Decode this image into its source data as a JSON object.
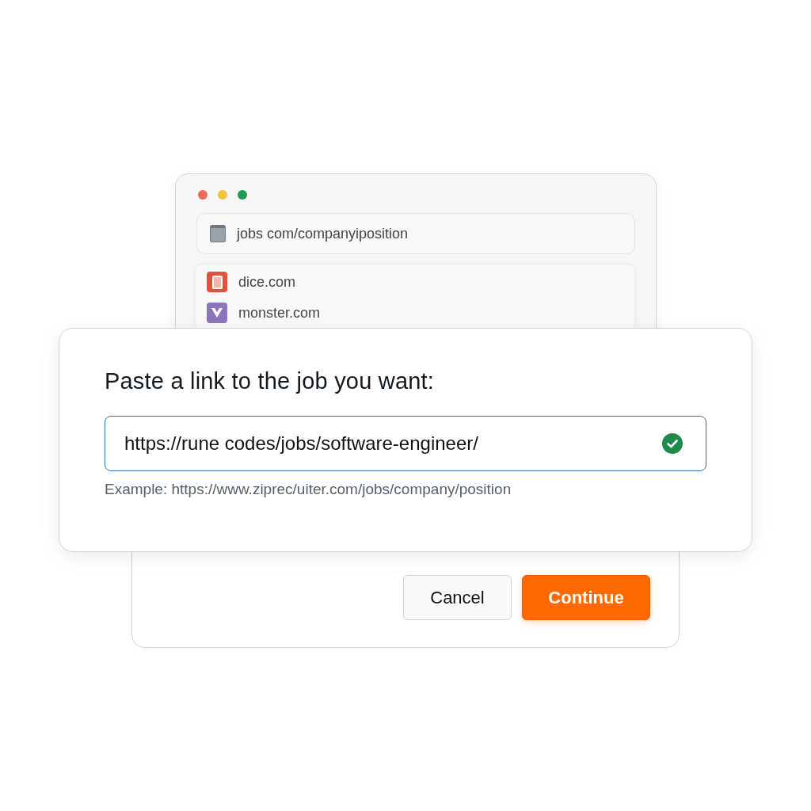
{
  "browser": {
    "address": "jobs com/companyiposition",
    "suggestions": [
      {
        "label": "dice.com",
        "kind": "dice"
      },
      {
        "label": "monster.com",
        "kind": "monster"
      }
    ]
  },
  "dialog": {
    "title": "Paste a link to the job you want:",
    "link_field": {
      "value": "https://rune codes/jobs/software-engineer/",
      "valid": true
    },
    "hint": "Example: https://www.ziprec/uiter.com/jobs/company/position"
  },
  "buttons": [
    {
      "label": "Cancel",
      "kind": "secondary"
    },
    {
      "label": "Continue",
      "kind": "primary"
    }
  ]
}
